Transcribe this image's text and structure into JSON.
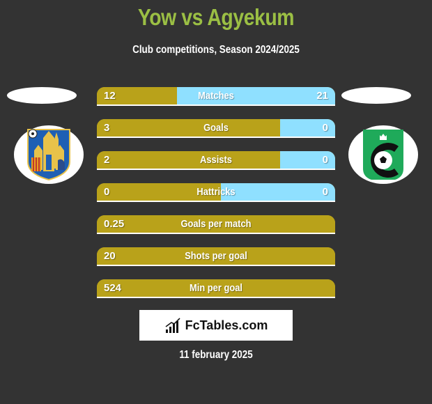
{
  "header": {
    "title": "Yow vs Agyekum",
    "subtitle": "Club competitions, Season 2024/2025"
  },
  "colors": {
    "left_bar": "#b9a21a",
    "right_bar": "#8fe0ff",
    "title": "#9bbf44",
    "background": "#333333"
  },
  "teams": {
    "left": {
      "logo_icon": "westerlo-crest-icon"
    },
    "right": {
      "logo_icon": "cercle-brugge-crest-icon"
    }
  },
  "stats": [
    {
      "label": "Matches",
      "left": "12",
      "right": "21",
      "left_share": 0.335,
      "has_right": true
    },
    {
      "label": "Goals",
      "left": "3",
      "right": "0",
      "left_share": 0.77,
      "has_right": true
    },
    {
      "label": "Assists",
      "left": "2",
      "right": "0",
      "left_share": 0.77,
      "has_right": true
    },
    {
      "label": "Hattricks",
      "left": "0",
      "right": "0",
      "left_share": 0.52,
      "has_right": true
    },
    {
      "label": "Goals per match",
      "left": "0.25",
      "right": "",
      "left_share": 1.0,
      "has_right": false
    },
    {
      "label": "Shots per goal",
      "left": "20",
      "right": "",
      "left_share": 1.0,
      "has_right": false
    },
    {
      "label": "Min per goal",
      "left": "524",
      "right": "",
      "left_share": 1.0,
      "has_right": false
    }
  ],
  "brand": {
    "text": "FcTables.com",
    "icon": "bar-chart-icon"
  },
  "footer": {
    "date": "11 february 2025"
  }
}
